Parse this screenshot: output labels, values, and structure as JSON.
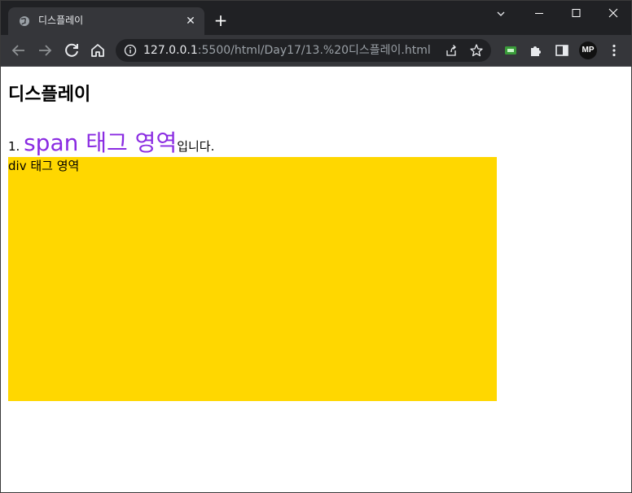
{
  "browser": {
    "tab": {
      "title": "디스플레이",
      "close_symbol": "✕",
      "favicon": "globe-icon"
    },
    "newtab_symbol": "+",
    "url": {
      "host": "127.0.0.1",
      "path": ":5500/html/Day17/13.%20디스플레이.html"
    },
    "extensions": {
      "profile_label": "MP"
    },
    "colors": {
      "frame": "#202124",
      "toolbar": "#35363a",
      "omnibox": "#202124",
      "text": "#e8eaed",
      "muted": "#9aa0a6"
    }
  },
  "page": {
    "heading": "디스플레이",
    "line": {
      "prefix": "1. ",
      "span_text": "span 태그 영역",
      "suffix": "입니다."
    },
    "div_text": "div 태그 영역",
    "colors": {
      "span": "#8a2be2",
      "div_background": "#ffd700"
    }
  }
}
